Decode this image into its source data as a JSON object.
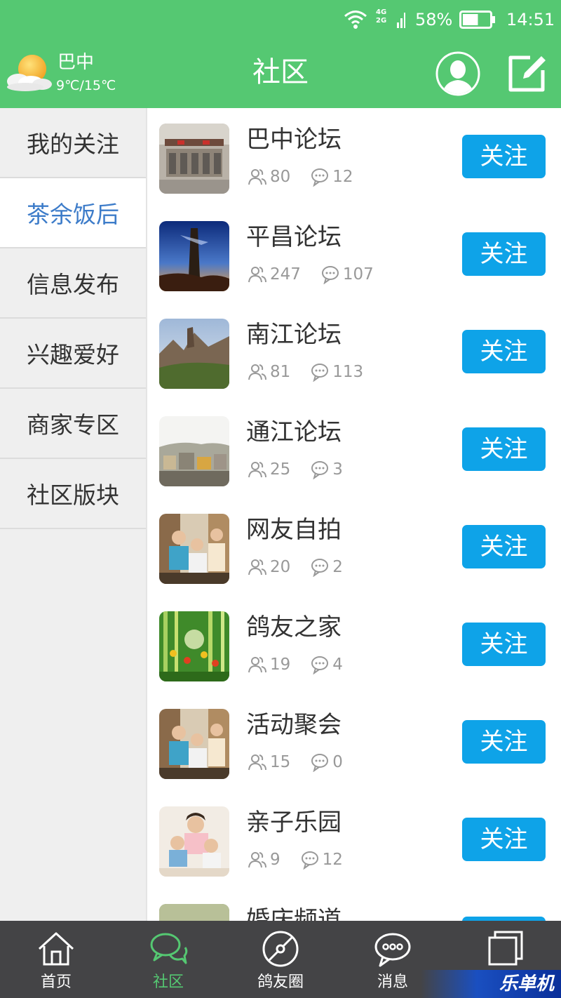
{
  "status_bar": {
    "network": "4G 2G",
    "battery_percent": "58%",
    "battery_level": 0.58,
    "time": "14:51"
  },
  "header": {
    "weather": {
      "city": "巴中",
      "temperature": "9℃/15℃",
      "icon": "partly-cloudy-icon"
    },
    "title": "社区",
    "user_icon": "user-avatar-icon",
    "edit_icon": "edit-icon"
  },
  "sidebar": {
    "items": [
      {
        "label": "我的关注",
        "active": false
      },
      {
        "label": "茶余饭后",
        "active": true
      },
      {
        "label": "信息发布",
        "active": false
      },
      {
        "label": "兴趣爱好",
        "active": false
      },
      {
        "label": "商家专区",
        "active": false
      },
      {
        "label": "社区版块",
        "active": false
      }
    ]
  },
  "forums": [
    {
      "name": "巴中论坛",
      "members": "80",
      "posts": "12",
      "button": "关注"
    },
    {
      "name": "平昌论坛",
      "members": "247",
      "posts": "107",
      "button": "关注"
    },
    {
      "name": "南江论坛",
      "members": "81",
      "posts": "113",
      "button": "关注"
    },
    {
      "name": "通江论坛",
      "members": "25",
      "posts": "3",
      "button": "关注"
    },
    {
      "name": "网友自拍",
      "members": "20",
      "posts": "2",
      "button": "关注"
    },
    {
      "name": "鸽友之家",
      "members": "19",
      "posts": "4",
      "button": "关注"
    },
    {
      "name": "活动聚会",
      "members": "15",
      "posts": "0",
      "button": "关注"
    },
    {
      "name": "亲子乐园",
      "members": "9",
      "posts": "12",
      "button": "关注"
    },
    {
      "name": "婚庆频道",
      "members": "",
      "posts": "",
      "button": ""
    }
  ],
  "bottom_nav": [
    {
      "label": "首页",
      "icon": "home-icon",
      "active": false
    },
    {
      "label": "社区",
      "icon": "chat-bubbles-icon",
      "active": true
    },
    {
      "label": "鸽友圈",
      "icon": "compass-icon",
      "active": false
    },
    {
      "label": "消息",
      "icon": "message-icon",
      "active": false
    },
    {
      "label": "",
      "icon": "window-icon",
      "active": false
    }
  ],
  "watermark": "乐单机",
  "colors": {
    "brand_green": "#55c872",
    "follow_blue": "#0ea3e8",
    "active_sidebar_text": "#3d7cc9",
    "nav_bg": "#444446"
  }
}
